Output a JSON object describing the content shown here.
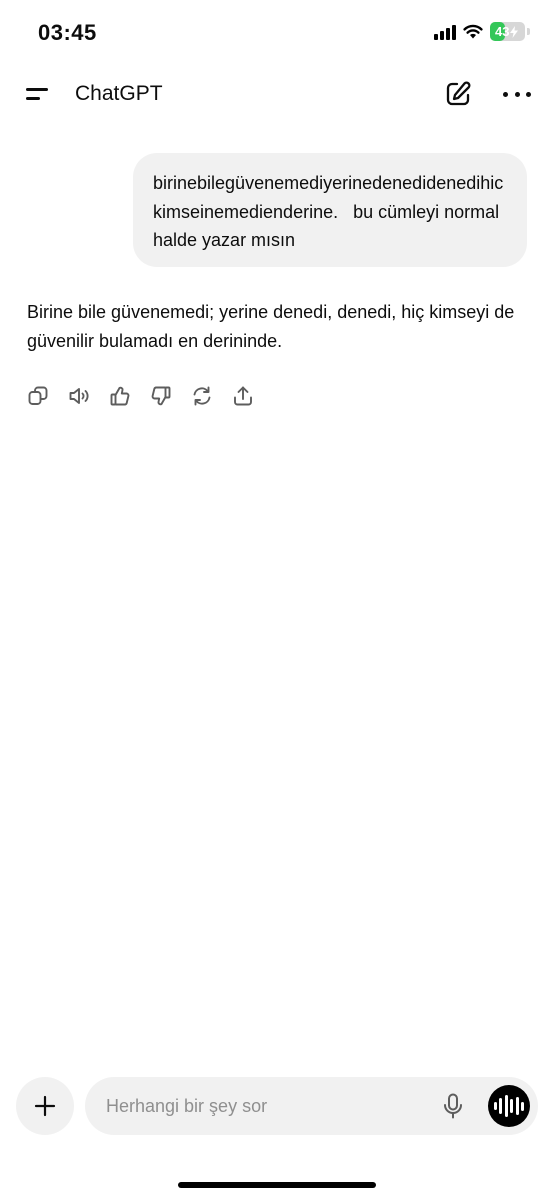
{
  "status_bar": {
    "time": "03:45",
    "battery_level": "43",
    "battery_percent": 43,
    "battery_color": "#34c759",
    "icons": [
      "signal-icon",
      "wifi-icon",
      "battery-charging-icon"
    ]
  },
  "header": {
    "title": "ChatGPT",
    "icons": [
      "menu-icon",
      "new-chat-icon",
      "more-icon"
    ]
  },
  "conversation": {
    "user_message": "birinebilegüvenemediyerinedenedidenedihickimseinemedienderine.   bu cümleyi normal halde yazar mısın",
    "assistant_message": "Birine bile güvenemedi; yerine denedi, denedi, hiç kimseyi de güvenilir bulamadı en derininde.",
    "actions": [
      "copy-icon",
      "read-aloud-icon",
      "thumbs-up-icon",
      "thumbs-down-icon",
      "regenerate-icon",
      "share-icon"
    ]
  },
  "composer": {
    "placeholder": "Herhangi bir şey sor",
    "icons": [
      "plus-icon",
      "mic-icon",
      "voice-mode-icon"
    ]
  },
  "colors": {
    "bubble_bg": "#f1f1f1",
    "text": "#0d0d0d",
    "placeholder": "#8f8f8f"
  }
}
